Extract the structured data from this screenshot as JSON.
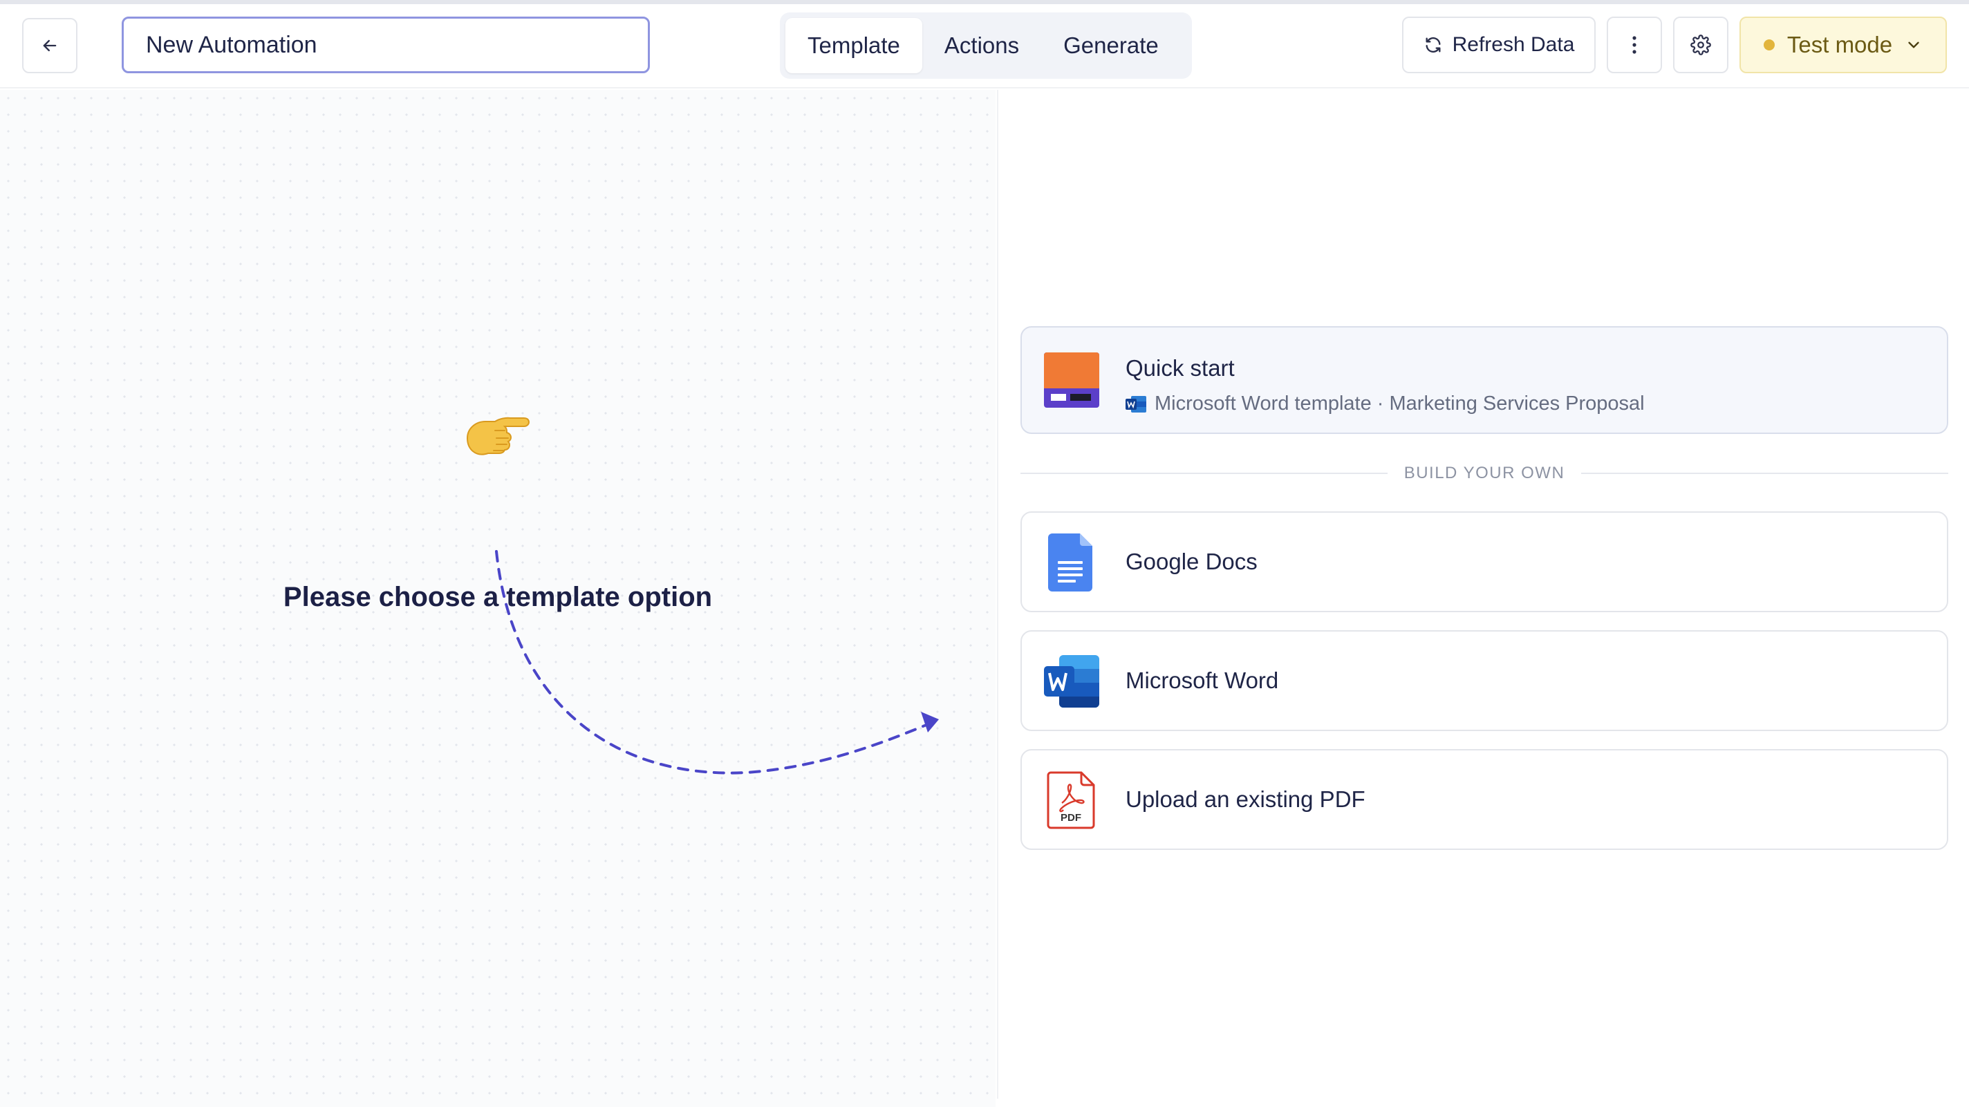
{
  "header": {
    "automation_name": "New Automation",
    "tabs": [
      {
        "label": "Template",
        "active": true
      },
      {
        "label": "Actions",
        "active": false
      },
      {
        "label": "Generate",
        "active": false
      }
    ],
    "refresh_label": "Refresh Data",
    "test_mode_label": "Test mode",
    "test_mode_dot_color": "#e2b53c",
    "icons": [
      "arrow-left-icon",
      "refresh-icon",
      "more-vertical-icon",
      "gear-icon",
      "chevron-down-icon"
    ]
  },
  "canvas": {
    "prompt": "Please choose a template option",
    "arrow_color": "#4a45c8",
    "icons": [
      "pointing-hand-icon"
    ]
  },
  "panel": {
    "quick_start": {
      "title": "Quick start",
      "subtitle": "Microsoft Word template · Marketing Services Proposal",
      "thumbnail_text": "Marketing Services Proposal"
    },
    "divider_label": "BUILD YOUR OWN",
    "options": [
      {
        "label": "Google Docs",
        "icon": "google-docs-icon"
      },
      {
        "label": "Microsoft Word",
        "icon": "microsoft-word-icon"
      },
      {
        "label": "Upload an existing PDF",
        "icon": "pdf-file-icon"
      }
    ]
  },
  "colors": {
    "accent": "#8f95e0",
    "test_mode_bg": "#fdf8dc",
    "quick_card_bg": "#f5f7fc"
  }
}
